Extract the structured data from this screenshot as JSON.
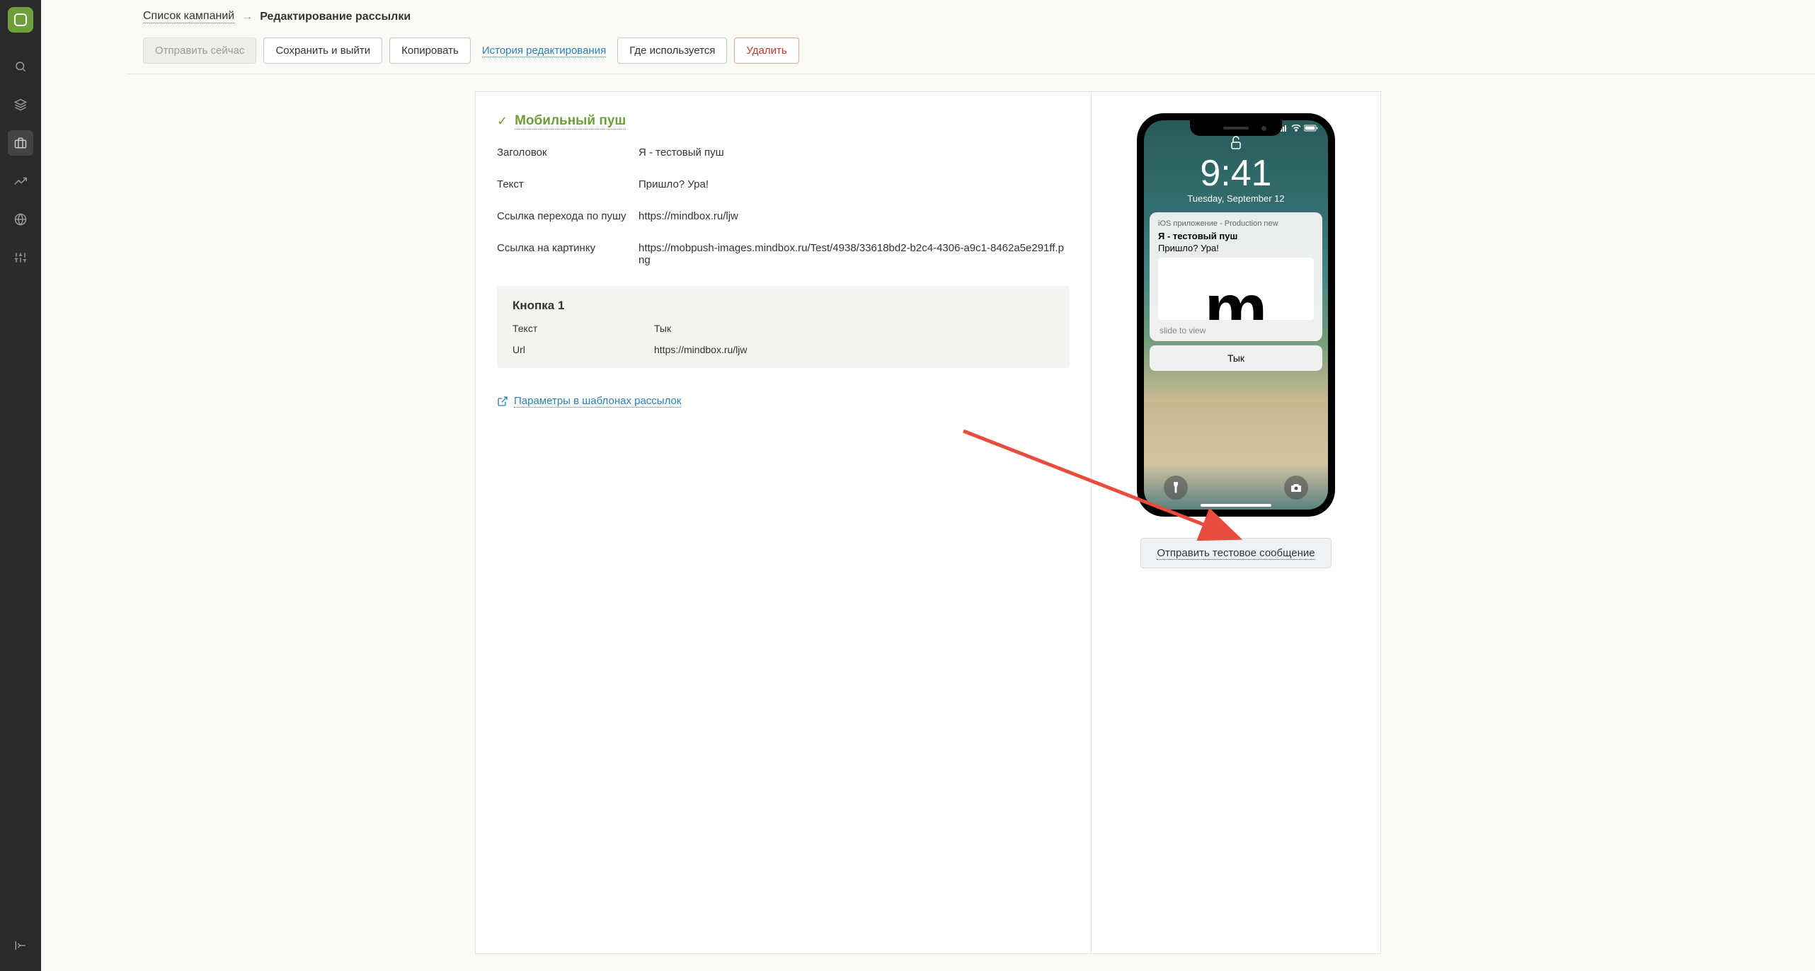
{
  "breadcrumb": {
    "back_link": "Список кампаний",
    "current": "Редактирование рассылки"
  },
  "toolbar": {
    "send_now": "Отправить сейчас",
    "save_exit": "Сохранить и выйти",
    "copy": "Копировать",
    "history": "История редактирования",
    "where_used": "Где используется",
    "delete": "Удалить"
  },
  "section": {
    "title": "Мобильный пуш"
  },
  "fields": {
    "title_label": "Заголовок",
    "title_value": "Я - тестовый пуш",
    "text_label": "Текст",
    "text_value": "Пришло? Ура!",
    "link_label": "Ссылка перехода по пушу",
    "link_value": "https://mindbox.ru/ljw",
    "image_label": "Ссылка на картинку",
    "image_value": "https://mobpush-images.mindbox.ru/Test/4938/33618bd2-b2c4-4306-a9c1-8462a5e291ff.png"
  },
  "button_block": {
    "title": "Кнопка 1",
    "text_label": "Текст",
    "text_value": "Тык",
    "url_label": "Url",
    "url_value": "https://mindbox.ru/ljw"
  },
  "params_link": "Параметры в шаблонах рассылок",
  "preview": {
    "time": "9:41",
    "date": "Tuesday, September 12",
    "app_name": "iOS приложение - Production new",
    "notif_title": "Я - тестовый пуш",
    "notif_text": "Пришло? Ура!",
    "slide": "slide to view",
    "action_button": "Тык"
  },
  "send_test": "Отправить тестовое сообщение"
}
